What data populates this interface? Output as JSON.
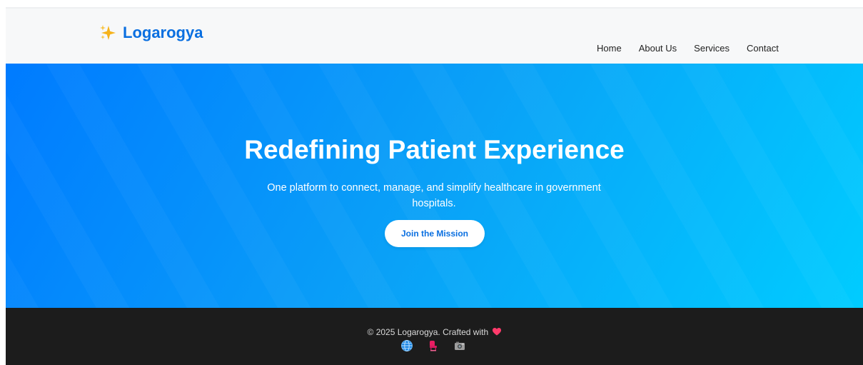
{
  "header": {
    "brand": "Logarogya",
    "nav": [
      "Home",
      "About Us",
      "Services",
      "Contact"
    ]
  },
  "hero": {
    "title": "Redefining Patient Experience",
    "subtitle": "One platform to connect, manage, and simplify healthcare in government hospitals.",
    "cta_label": "Join the Mission"
  },
  "footer": {
    "text": "© 2025 Logarogya. Crafted with",
    "social_icons": [
      "globe-icon",
      "chair-icon",
      "camera-icon"
    ]
  },
  "colors": {
    "brand": "#0a6fe0",
    "hero_start": "#007bff",
    "hero_end": "#00ccff",
    "footer_bg": "#1c1c1c",
    "heart": "#ff3b6b"
  }
}
